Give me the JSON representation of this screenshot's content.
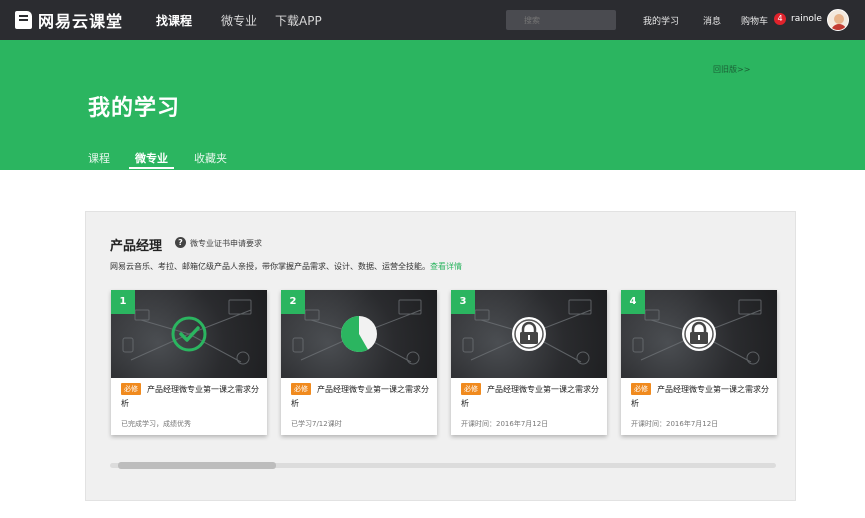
{
  "topnav": {
    "logo_text": "网易云课堂",
    "links": [
      "找课程",
      "微专业",
      "下载APP"
    ],
    "search_placeholder": "搜索",
    "my_learning": "我的学习",
    "messages": "消息",
    "cart": "购物车",
    "cart_count": "4",
    "username": "rainole"
  },
  "banner": {
    "old_version_link": "回旧版>>",
    "title": "我的学习",
    "tabs": [
      "课程",
      "微专业",
      "收藏夹"
    ],
    "active_tab": "微专业"
  },
  "section": {
    "title": "产品经理",
    "help_text": "微专业证书申请要求",
    "description": "网易云音乐、考拉、邮箱亿级产品人亲授，带你掌握产品需求、设计、数据、运营全技能。",
    "detail_link": "查看详情"
  },
  "cards": [
    {
      "number": "1",
      "tag": "必修",
      "title": "产品经理微专业第一课之需求分析",
      "status": "已完成学习，成绩优秀",
      "state": "completed",
      "progress": 1.0
    },
    {
      "number": "2",
      "tag": "必修",
      "title": "产品经理微专业第一课之需求分析",
      "status": "已学习7/12课时",
      "state": "in-progress",
      "progress": 0.5833
    },
    {
      "number": "3",
      "tag": "必修",
      "title": "产品经理微专业第一课之需求分析",
      "status": "开课时间：2016年7月12日",
      "state": "locked",
      "progress": 0
    },
    {
      "number": "4",
      "tag": "必修",
      "title": "产品经理微专业第一课之需求分析",
      "status": "开课时间：2016年7月12日",
      "state": "locked",
      "progress": 0
    }
  ],
  "colors": {
    "brand_green": "#2bb560",
    "nav_bg": "#2b2c30",
    "tag_orange": "#f08a1e",
    "badge_red": "#e0222b"
  }
}
